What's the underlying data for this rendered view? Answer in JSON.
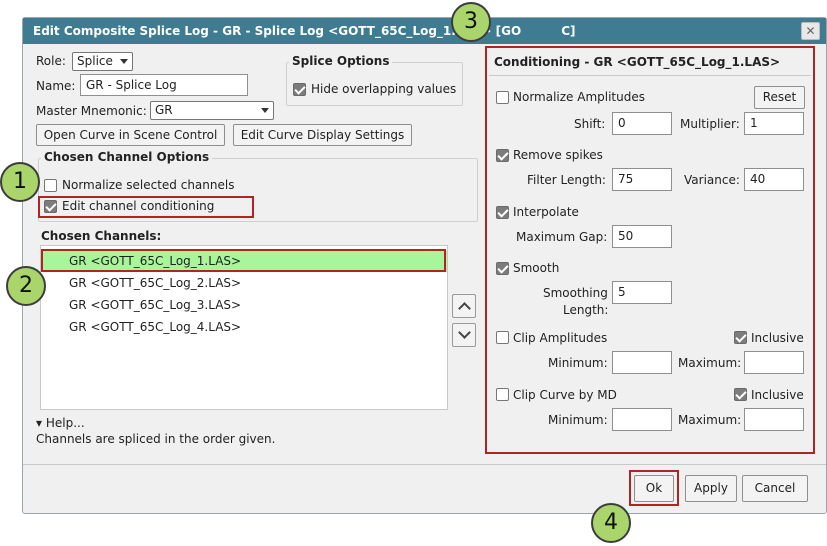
{
  "dialog": {
    "title": "Edit Composite Splice Log - GR - Splice Log <GOTT_65C_Log_1.LAS> [GO",
    "title_tail": "C]",
    "close_glyph": "✕"
  },
  "role": {
    "label": "Role:",
    "value": "Splice"
  },
  "name": {
    "label": "Name:",
    "value": "GR - Splice Log"
  },
  "master": {
    "label": "Master Mnemonic:",
    "value": "GR"
  },
  "splice_options": {
    "title": "Splice Options",
    "hide_overlapping_label": "Hide overlapping values",
    "hide_overlapping_checked": true
  },
  "buttons": {
    "open_curve": "Open Curve in Scene Control",
    "edit_display": "Edit Curve Display Settings",
    "ok": "Ok",
    "apply": "Apply",
    "cancel": "Cancel",
    "reset": "Reset"
  },
  "chosen_channel_options": {
    "title": "Chosen Channel Options",
    "normalize_label": "Normalize selected channels",
    "normalize_checked": false,
    "edit_conditioning_label": "Edit channel conditioning",
    "edit_conditioning_checked": true
  },
  "chosen_channels": {
    "title": "Chosen Channels:",
    "items": [
      "GR <GOTT_65C_Log_1.LAS>",
      "GR <GOTT_65C_Log_2.LAS>",
      "GR <GOTT_65C_Log_3.LAS>",
      "GR <GOTT_65C_Log_4.LAS>"
    ],
    "selected_index": 0
  },
  "help": {
    "toggle": "▾ Help...",
    "text": "Channels are spliced in the order given."
  },
  "conditioning": {
    "title": "Conditioning - GR <GOTT_65C_Log_1.LAS>",
    "normalize_amplitudes": {
      "label": "Normalize Amplitudes",
      "checked": false
    },
    "shift": {
      "label": "Shift:",
      "value": "0"
    },
    "multiplier": {
      "label": "Multiplier:",
      "value": "1"
    },
    "remove_spikes": {
      "label": "Remove spikes",
      "checked": true
    },
    "filter_length": {
      "label": "Filter Length:",
      "value": "75"
    },
    "variance": {
      "label": "Variance:",
      "value": "40"
    },
    "interpolate": {
      "label": "Interpolate",
      "checked": true
    },
    "maximum_gap": {
      "label": "Maximum Gap:",
      "value": "50"
    },
    "smooth": {
      "label": "Smooth",
      "checked": true
    },
    "smoothing_length": {
      "label_line1": "Smoothing",
      "label_line2": "Length:",
      "value": "5"
    },
    "clip_amplitudes": {
      "label": "Clip Amplitudes",
      "checked": false,
      "inclusive_label": "Inclusive",
      "inclusive_checked": true,
      "min_label": "Minimum:",
      "max_label": "Maximum:",
      "min_value": "",
      "max_value": ""
    },
    "clip_md": {
      "label": "Clip Curve by MD",
      "checked": false,
      "inclusive_label": "Inclusive",
      "inclusive_checked": true,
      "min_label": "Minimum:",
      "max_label": "Maximum:",
      "min_value": "",
      "max_value": ""
    }
  },
  "callouts": [
    "1",
    "2",
    "3",
    "4"
  ],
  "colors": {
    "titlebar": "#3f7c92",
    "highlight": "#a8f59a",
    "callout": "#a9d56a",
    "annotation_red": "#b22424"
  }
}
